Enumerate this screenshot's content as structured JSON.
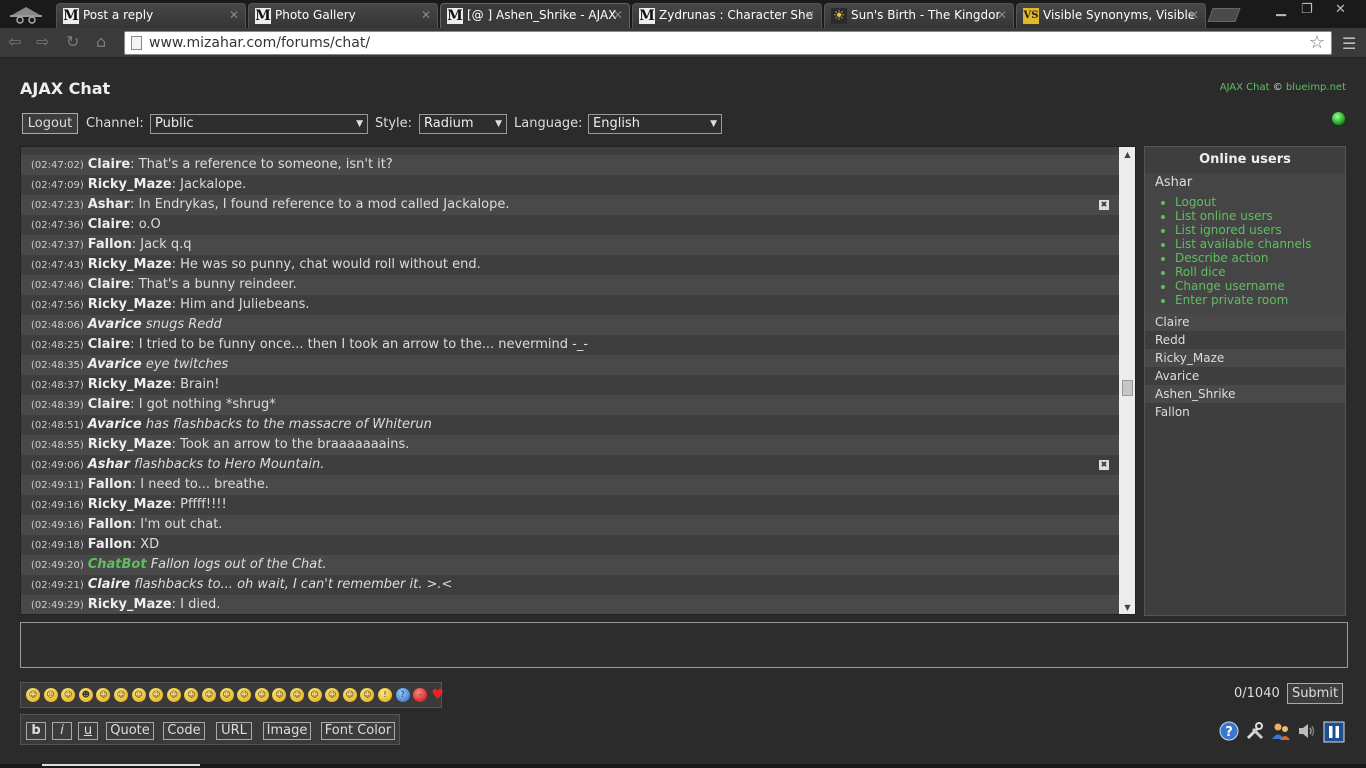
{
  "browser": {
    "tabs": [
      {
        "label": "Post a reply",
        "favicon": "M"
      },
      {
        "label": "Photo Gallery",
        "favicon": "M"
      },
      {
        "label": "[@ ] Ashen_Shrike - AJAX",
        "favicon": "M"
      },
      {
        "label": "Zydrunas : Character She",
        "favicon": "M"
      },
      {
        "label": "Sun's Birth - The Kingdor",
        "favicon": "sun-icon"
      },
      {
        "label": "Visible Synonyms, Visible",
        "favicon": "vs-icon"
      }
    ],
    "url": "www.mizahar.com/forums/chat/",
    "icons": [
      "back-icon",
      "forward-icon",
      "reload-icon",
      "home-icon",
      "star-icon",
      "menu-icon"
    ]
  },
  "chat": {
    "title": "AJAX Chat",
    "credits": {
      "app": "AJAX Chat",
      "sep": "©",
      "author": "blueimp.net"
    },
    "logout_label": "Logout",
    "channel": {
      "label": "Channel:",
      "value": "Public"
    },
    "style": {
      "label": "Style:",
      "value": "Radium"
    },
    "language": {
      "label": "Language:",
      "value": "English"
    },
    "status_color": "#22aa22",
    "messages": [
      {
        "time": "(02:47:02)",
        "user": "Claire",
        "text": "That's a reference to someone, isn't it?",
        "action": false
      },
      {
        "time": "(02:47:09)",
        "user": "Ricky_Maze",
        "text": "Jackalope.",
        "action": false
      },
      {
        "time": "(02:47:23)",
        "user": "Ashar",
        "text": "In Endrykas, I found reference to a mod called Jackalope.",
        "action": false,
        "deletable": true
      },
      {
        "time": "(02:47:36)",
        "user": "Claire",
        "text": "o.O",
        "action": false
      },
      {
        "time": "(02:47:37)",
        "user": "Fallon",
        "text": "Jack q.q",
        "action": false
      },
      {
        "time": "(02:47:43)",
        "user": "Ricky_Maze",
        "text": "He was so punny, chat would roll without end.",
        "action": false
      },
      {
        "time": "(02:47:46)",
        "user": "Claire",
        "text": "That's a bunny reindeer.",
        "action": false
      },
      {
        "time": "(02:47:56)",
        "user": "Ricky_Maze",
        "text": "Him and Juliebeans.",
        "action": false
      },
      {
        "time": "(02:48:06)",
        "user": "Avarice",
        "text": "snugs Redd",
        "action": true
      },
      {
        "time": "(02:48:25)",
        "user": "Claire",
        "text": "I tried to be funny once... then I took an arrow to the... nevermind -_-",
        "action": false
      },
      {
        "time": "(02:48:35)",
        "user": "Avarice",
        "text": "eye twitches",
        "action": true
      },
      {
        "time": "(02:48:37)",
        "user": "Ricky_Maze",
        "text": "Brain!",
        "action": false
      },
      {
        "time": "(02:48:39)",
        "user": "Claire",
        "text": "I got nothing *shrug*",
        "action": false
      },
      {
        "time": "(02:48:51)",
        "user": "Avarice",
        "text": "has flashbacks to the massacre of Whiterun",
        "action": true
      },
      {
        "time": "(02:48:55)",
        "user": "Ricky_Maze",
        "text": "Took an arrow to the braaaaaaains.",
        "action": false
      },
      {
        "time": "(02:49:06)",
        "user": "Ashar",
        "text": "flashbacks to Hero Mountain.",
        "action": true,
        "deletable": true
      },
      {
        "time": "(02:49:11)",
        "user": "Fallon",
        "text": "I need to... breathe.",
        "action": false
      },
      {
        "time": "(02:49:16)",
        "user": "Ricky_Maze",
        "text": "Pffff!!!!",
        "action": false
      },
      {
        "time": "(02:49:16)",
        "user": "Fallon",
        "text": "I'm out chat.",
        "action": false
      },
      {
        "time": "(02:49:18)",
        "user": "Fallon",
        "text": "XD",
        "action": false
      },
      {
        "time": "(02:49:20)",
        "user": "ChatBot",
        "text": "Fallon logs out of the Chat.",
        "action": true,
        "bot": true
      },
      {
        "time": "(02:49:21)",
        "user": "Claire",
        "text": "flashbacks to... oh wait, I can't remember it. >.<",
        "action": true
      },
      {
        "time": "(02:49:29)",
        "user": "Ricky_Maze",
        "text": "I died.",
        "action": false
      }
    ],
    "online": {
      "heading": "Online users",
      "me": "Ashar",
      "menu": [
        "Logout",
        "List online users",
        "List ignored users",
        "List available channels",
        "Describe action",
        "Roll dice",
        "Change username",
        "Enter private room"
      ],
      "users": [
        "Claire",
        "Redd",
        "Ricky_Maze",
        "Avarice",
        "Ashen_Shrike",
        "Fallon"
      ]
    },
    "counter": "0/1040",
    "submit_label": "Submit",
    "bbcode": [
      "b",
      "i",
      "u",
      "Quote",
      "Code",
      "URL",
      "Image",
      "Font Color"
    ],
    "emoticon_count": 24,
    "bottom_icons": [
      "help-icon",
      "settings-icon",
      "users-icon",
      "sound-icon",
      "pause-icon"
    ]
  }
}
